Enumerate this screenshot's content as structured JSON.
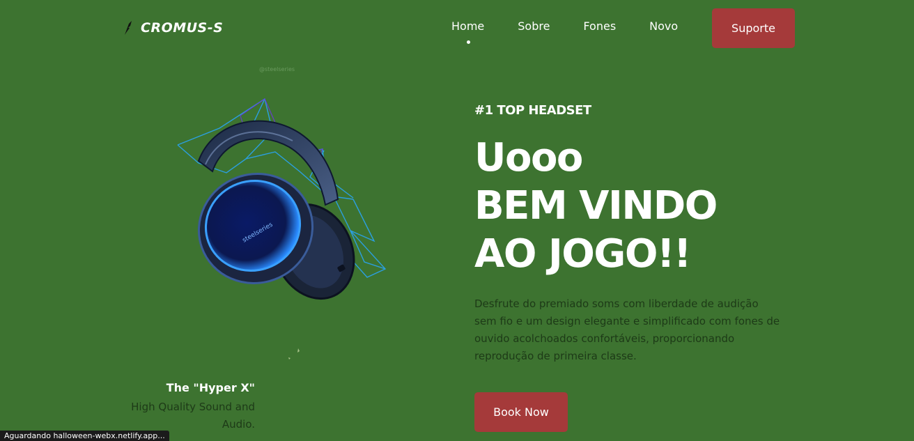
{
  "header": {
    "logo_icon": "feather-icon",
    "logo_text": "CROMUS-S",
    "nav": [
      "Home",
      "Sobre",
      "Fones",
      "Novo"
    ],
    "active_nav": "Home",
    "support_label": "Suporte"
  },
  "hero": {
    "image_icon": "headset-illustration",
    "watermark": "@steelseries",
    "product_name": "The \"Hyper X\"",
    "product_desc": "High Quality Sound and Audio.",
    "tagline": "#1 TOP HEADSET",
    "headline_lines": [
      "Uooo",
      "BEM VINDO",
      "AO JOGO!!"
    ],
    "description": "Desfrute do premiado soms com liberdade de audição sem fio e um design elegante e simplificado com fones de ouvido acolchoados confortáveis, proporcionando reprodução de primeira classe.",
    "book_label": "Book Now"
  },
  "status_bar": {
    "text": "Aguardando halloween-webx.netlify.app..."
  },
  "colors": {
    "background": "#3d7330",
    "button": "#a53a3a",
    "body_text": "#1d3a17",
    "headline": "#ffffff"
  }
}
